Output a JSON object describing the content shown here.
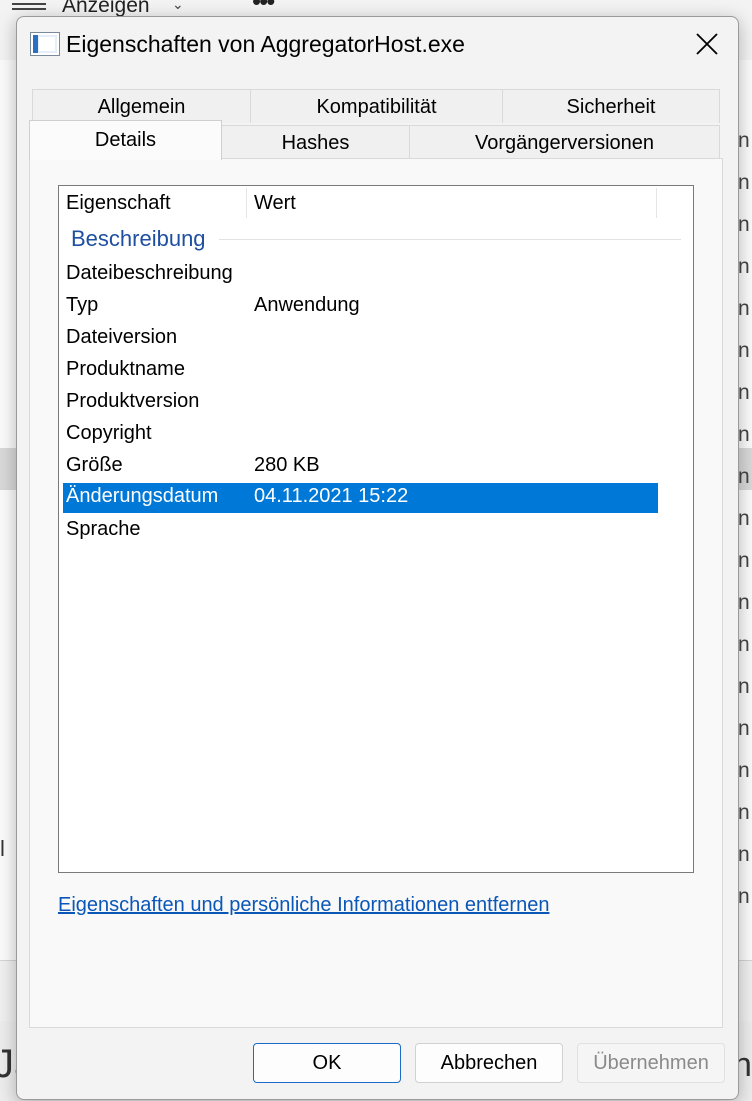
{
  "background": {
    "view_label": "Anzeigen",
    "right_column_glyph": "n",
    "left_mark": "l",
    "bottom_left_text": "Ja",
    "bottom_right_text": "n"
  },
  "dialog": {
    "title": "Eigenschaften von AggregatorHost.exe",
    "tabs_row1": [
      "Allgemein",
      "Kompatibilität",
      "Sicherheit"
    ],
    "tabs_row2": [
      "Details",
      "Hashes",
      "Vorgängerversionen"
    ],
    "active_tab": "Details",
    "list": {
      "col_property": "Eigenschaft",
      "col_value": "Wert",
      "group": "Beschreibung",
      "rows": [
        {
          "property": "Dateibeschreibung",
          "value": ""
        },
        {
          "property": "Typ",
          "value": "Anwendung"
        },
        {
          "property": "Dateiversion",
          "value": ""
        },
        {
          "property": "Produktname",
          "value": ""
        },
        {
          "property": "Produktversion",
          "value": ""
        },
        {
          "property": "Copyright",
          "value": ""
        },
        {
          "property": "Größe",
          "value": "280 KB"
        },
        {
          "property": "Änderungsdatum",
          "value": "04.11.2021 15:22"
        },
        {
          "property": "Sprache",
          "value": ""
        }
      ],
      "selected_row": "Änderungsdatum"
    },
    "link": "Eigenschaften und persönliche Informationen entfernen",
    "buttons": {
      "ok": "OK",
      "cancel": "Abbrechen",
      "apply": "Übernehmen"
    },
    "colors": {
      "selection": "#0078d7",
      "link": "#0a57b8",
      "group_header": "#1f4fa0"
    }
  }
}
